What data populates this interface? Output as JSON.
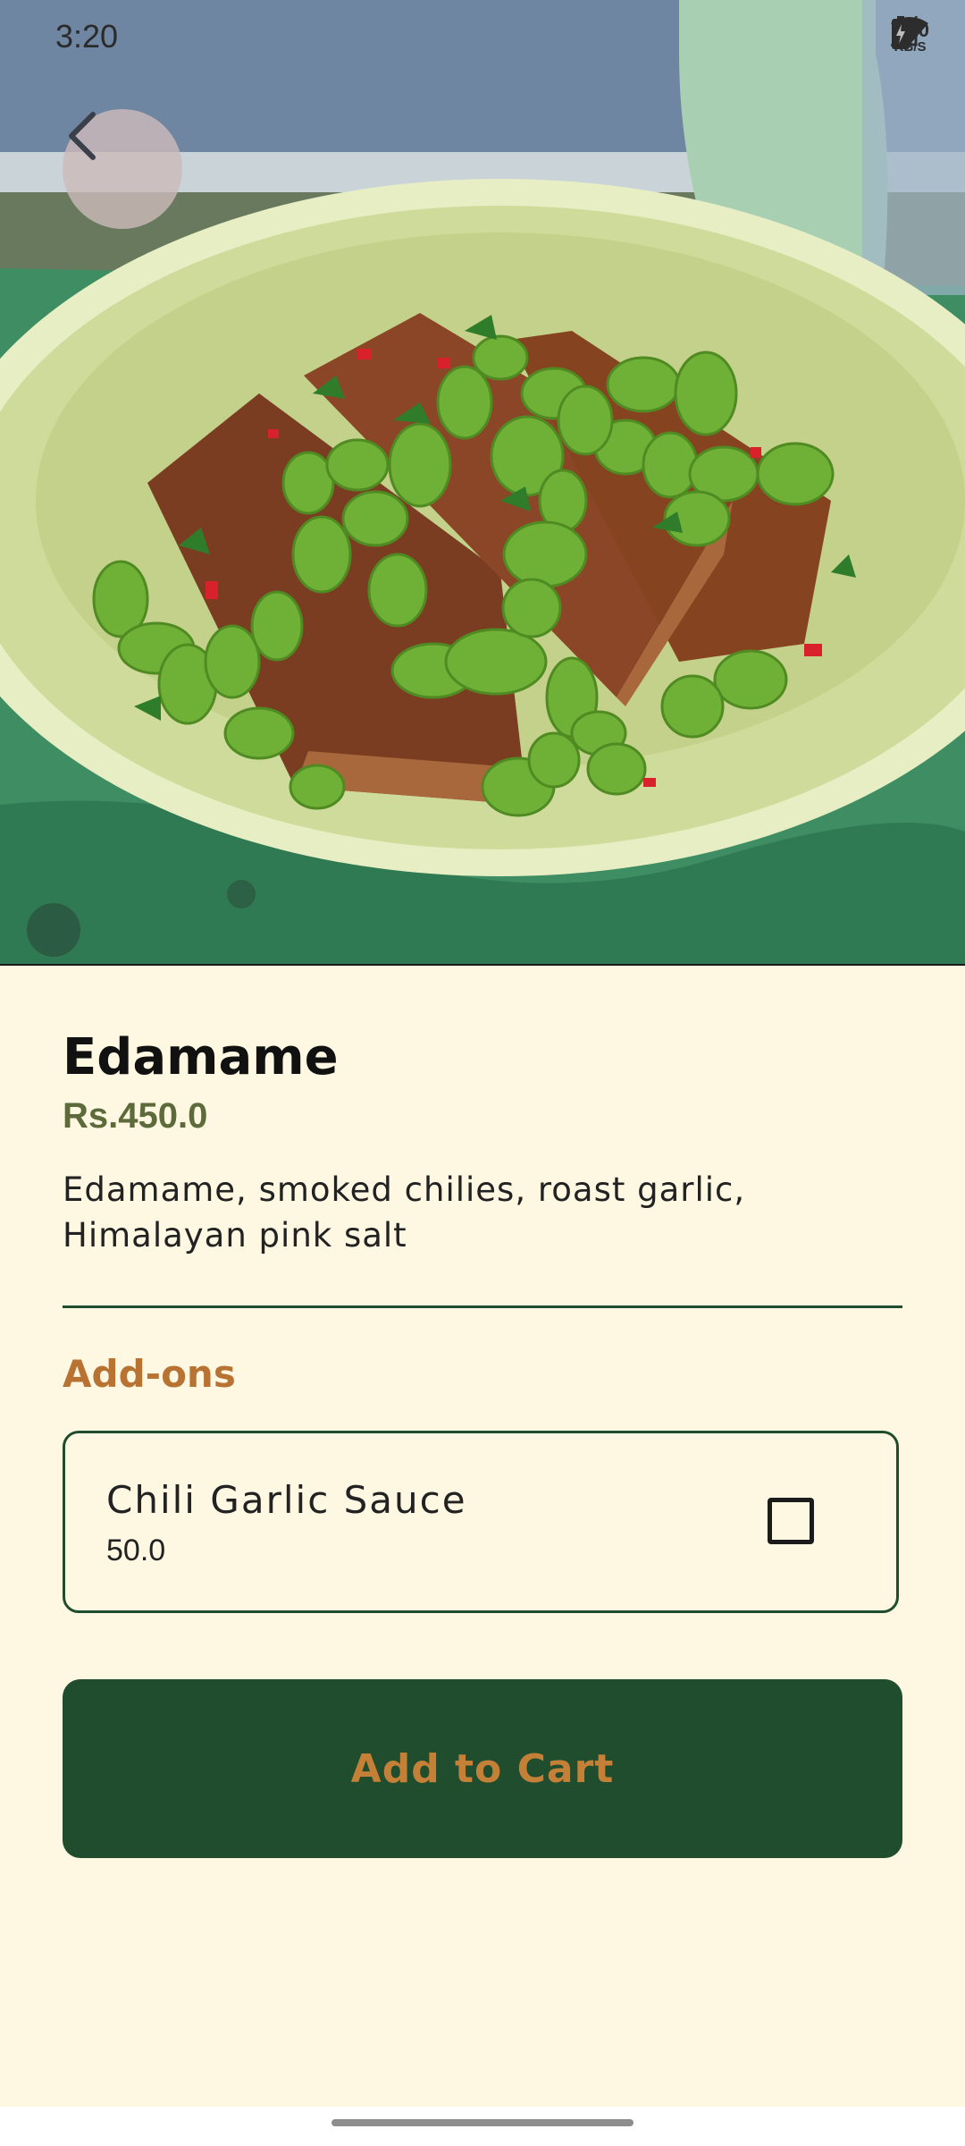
{
  "status_bar": {
    "time": "3:20",
    "net_speed_value": "0.20",
    "net_speed_unit": "KB/S",
    "icons": [
      "wifi-icon",
      "signal-icon",
      "signal-icon",
      "battery-charging-icon"
    ]
  },
  "header": {
    "back_icon": "chevron-left-icon"
  },
  "item": {
    "name": "Edamame",
    "price": "Rs.450.0",
    "description": "Edamame, smoked chilies, roast garlic, Himalayan pink salt"
  },
  "addons": {
    "title": "Add-ons",
    "items": [
      {
        "name": "Chili Garlic Sauce",
        "price": "50.0",
        "checked": false
      }
    ]
  },
  "actions": {
    "add_to_cart_label": "Add to Cart"
  },
  "colors": {
    "background": "#FEF8E3",
    "primary": "#1F4D2D",
    "accent": "#C48036",
    "price": "#5D6B3B"
  }
}
